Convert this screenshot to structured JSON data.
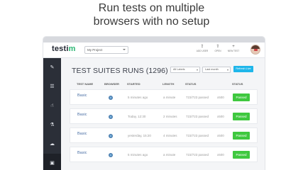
{
  "headline": {
    "line1": "Run tests on multiple",
    "line2": "browsers with no setup"
  },
  "app": {
    "logo_main": "testi",
    "logo_accent": "m",
    "project_select": "My Project",
    "actions": [
      {
        "icon": "add-user-icon",
        "glyph": "⇪",
        "label": "ADD USER"
      },
      {
        "icon": "open-icon",
        "glyph": "⇧",
        "label": "OPEN"
      },
      {
        "icon": "plus-icon",
        "glyph": "+",
        "label": "NEW TEST"
      }
    ]
  },
  "sidebar": {
    "items": [
      {
        "icon": "pen-icon",
        "glyph": "✎"
      },
      {
        "icon": "list-icon",
        "glyph": "☰"
      },
      {
        "icon": "pointer-icon",
        "glyph": "☝"
      },
      {
        "icon": "flask-icon",
        "glyph": "⚗"
      },
      {
        "icon": "cloud-icon",
        "glyph": "☁"
      },
      {
        "icon": "suites-icon",
        "glyph": "▣"
      }
    ],
    "active_index": 5
  },
  "page": {
    "title": "TEST SUITES RUNS (1296)",
    "filter_labels": "All Labels",
    "filter_time": "Last month",
    "refresh_label": "Refresh Live"
  },
  "table": {
    "columns": [
      "TEST NAME",
      "BROWSER",
      "STARTED",
      "LENGTH",
      "STATUS",
      "STATUS"
    ],
    "rows": [
      {
        "name": "Basic",
        "browser": "chrome",
        "started": "5 minutes ago",
        "length": "a minute",
        "passed": "723/723 passed",
        "x": "x500",
        "status": "Passed"
      },
      {
        "name": "Basic",
        "browser": "chrome",
        "started": "Today, 12:30",
        "length": "2 minutes",
        "passed": "723/723 passed",
        "x": "x500",
        "status": "Passed"
      },
      {
        "name": "Basic",
        "browser": "chrome",
        "started": "yesterday, 15:20",
        "length": "4 minutes",
        "passed": "723/723 passed",
        "x": "x500",
        "status": "Passed"
      },
      {
        "name": "Basic",
        "browser": "chrome",
        "started": "5 minutes ago",
        "length": "a minute",
        "passed": "723/723 passed",
        "x": "x500",
        "status": "Passed"
      }
    ]
  },
  "colors": {
    "accent": "#1fb6ea",
    "passed": "#3fc83f",
    "sidebar": "#2b2f38"
  }
}
